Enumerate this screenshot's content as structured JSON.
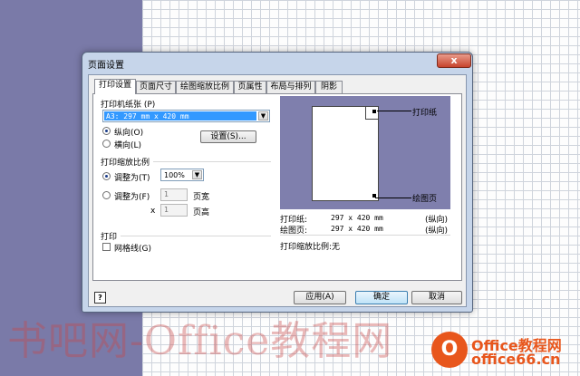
{
  "dialog": {
    "title": "页面设置",
    "close_glyph": "x",
    "tabs": [
      {
        "label": "打印设置",
        "active": true
      },
      {
        "label": "页面尺寸",
        "active": false
      },
      {
        "label": "绘图缩放比例",
        "active": false
      },
      {
        "label": "页属性",
        "active": false
      },
      {
        "label": "布局与排列",
        "active": false
      },
      {
        "label": "阴影",
        "active": false
      }
    ]
  },
  "print_paper": {
    "section_label": "打印机纸张 (P)",
    "paper_value": "A3:  297 mm x 420 mm",
    "portrait_label": "纵向(O)",
    "landscape_label": "横向(L)",
    "orientation_selected": "portrait",
    "setup_button": "设置(S)..."
  },
  "print_zoom": {
    "section_label": "打印缩放比例",
    "adjust_to_label": "调整为(T)",
    "adjust_to_value": "100%",
    "fit_to_label": "调整为(F)",
    "pages_wide_value": "1",
    "pages_wide_label": "页宽",
    "times_glyph": "x",
    "pages_high_value": "1",
    "pages_high_label": "页高",
    "selected": "adjust_to"
  },
  "print": {
    "section_label": "打印",
    "gridlines_label": "网格线(G)",
    "gridlines_checked": false
  },
  "preview": {
    "paper_callout": "打印纸",
    "drawing_callout": "绘图页",
    "paper_row": {
      "label": "打印纸:",
      "size": "297 x 420 mm",
      "orientation": "(纵向)"
    },
    "drawing_row": {
      "label": "绘图页:",
      "size": "297 x 420 mm",
      "orientation": "(纵向)"
    },
    "zoom_text": "打印缩放比例:无",
    "background_color": "#7f7fad"
  },
  "footer": {
    "help_glyph": "?",
    "apply_button": "应用(A)",
    "ok_button": "确定",
    "cancel_button": "取消"
  },
  "watermark": {
    "text": "书吧网-Office教程网"
  },
  "logo": {
    "mark": "O",
    "line1": "Office教程网",
    "line2": "office66.cn",
    "color": "#e8561c"
  }
}
